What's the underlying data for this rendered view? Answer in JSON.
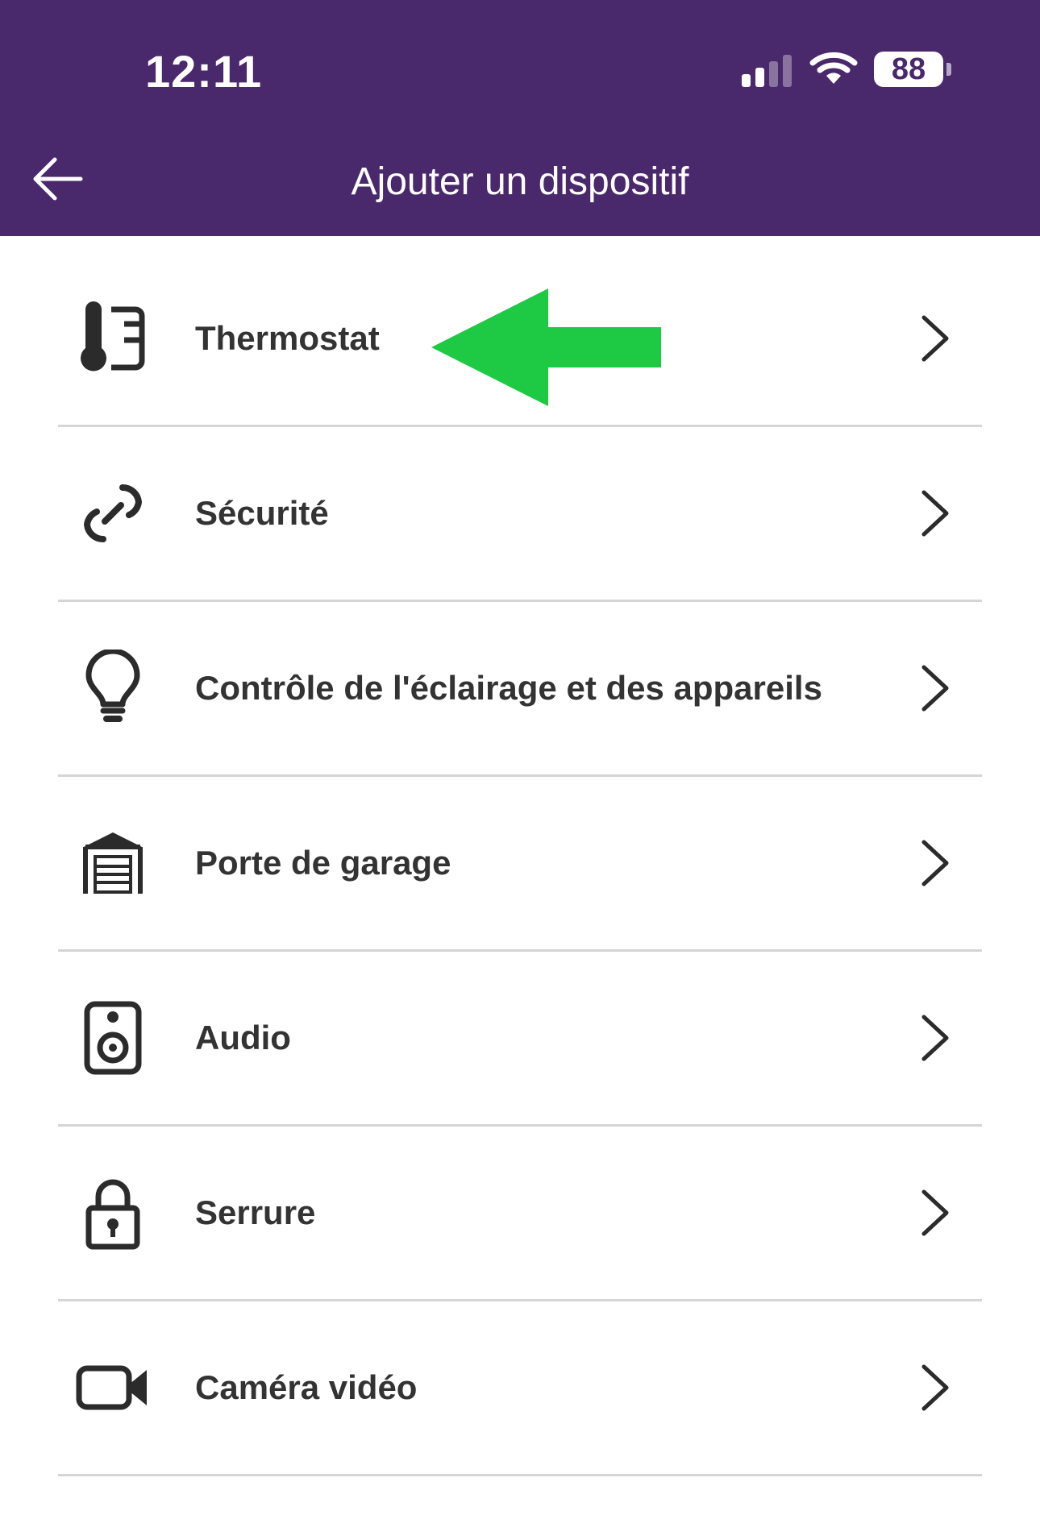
{
  "status_bar": {
    "time": "12:11",
    "battery": "88",
    "signal_bars_active": 2,
    "signal_bars_total": 4
  },
  "header": {
    "title": "Ajouter un dispositif",
    "back_icon": "arrow-left-icon"
  },
  "items": [
    {
      "label": "Thermostat",
      "icon": "thermostat-icon"
    },
    {
      "label": "Sécurité",
      "icon": "security-link-icon"
    },
    {
      "label": "Contrôle de l'éclairage et des appareils",
      "icon": "lightbulb-icon"
    },
    {
      "label": "Porte de garage",
      "icon": "garage-icon"
    },
    {
      "label": "Audio",
      "icon": "speaker-icon"
    },
    {
      "label": "Serrure",
      "icon": "lock-icon"
    },
    {
      "label": "Caméra vidéo",
      "icon": "video-camera-icon"
    }
  ],
  "colors": {
    "header_bg": "#4a286c",
    "text": "#333333",
    "divider": "#d5d5d5",
    "annotation_arrow": "#1ec944",
    "icon": "#2b2b2b"
  },
  "annotation": {
    "icon": "green-arrow-icon",
    "points_to": "Thermostat"
  }
}
